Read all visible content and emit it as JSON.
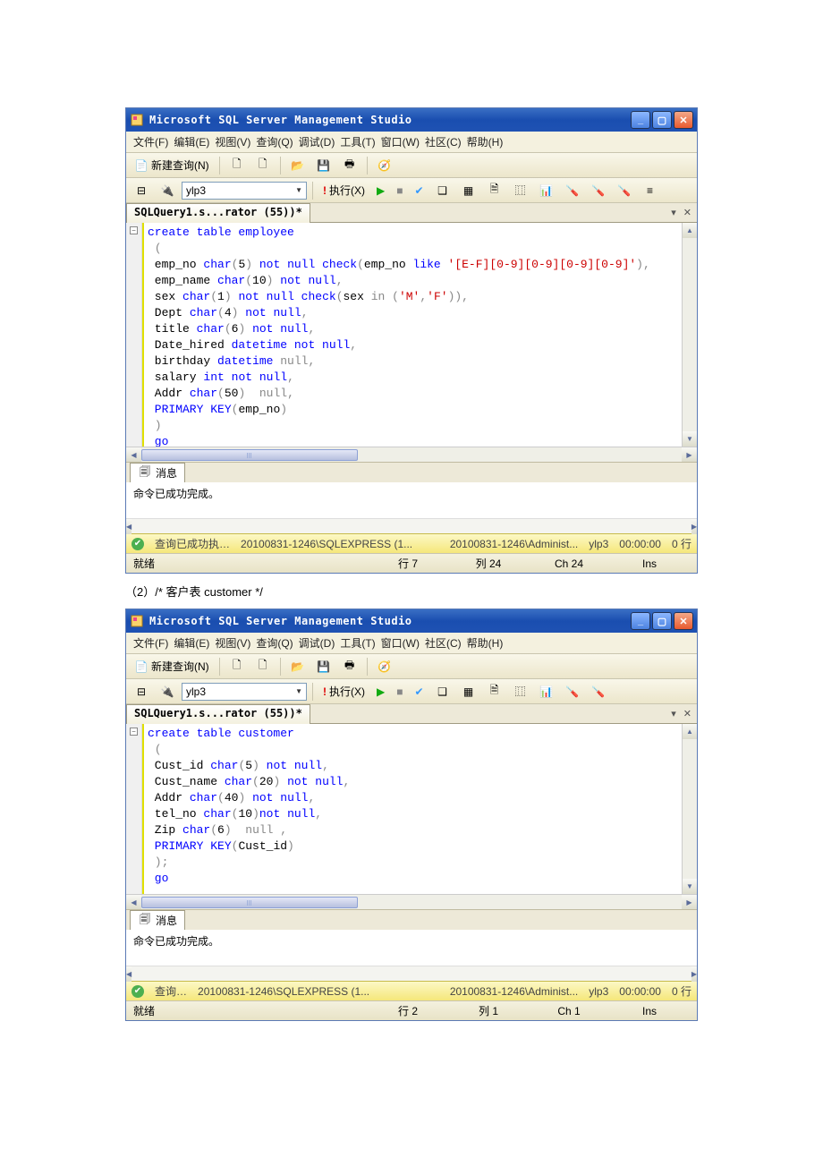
{
  "window1": {
    "title": "Microsoft SQL Server Management Studio",
    "menu": [
      "文件(F)",
      "编辑(E)",
      "视图(V)",
      "查询(Q)",
      "调试(D)",
      "工具(T)",
      "窗口(W)",
      "社区(C)",
      "帮助(H)"
    ],
    "toolbar": {
      "new_query": "新建查询(N)"
    },
    "db": "ylp3",
    "execute": "执行(X)",
    "doc_tab": "SQLQuery1.s...rator (55))*",
    "code_lines": [
      {
        "t": "create table employee",
        "cls": "kw-blue",
        "box": "-"
      },
      {
        "t": " (",
        "cls": "kw-gray"
      },
      {
        "segs": [
          {
            "t": " emp_no ",
            "c": ""
          },
          {
            "t": "char",
            "c": "kw-blue"
          },
          {
            "t": "(",
            "c": "kw-gray"
          },
          {
            "t": "5",
            "c": ""
          },
          {
            "t": ") ",
            "c": "kw-gray"
          },
          {
            "t": "not null check",
            "c": "kw-blue"
          },
          {
            "t": "(",
            "c": "kw-gray"
          },
          {
            "t": "emp_no ",
            "c": ""
          },
          {
            "t": "like ",
            "c": "kw-blue"
          },
          {
            "t": "'[E-F][0-9][0-9][0-9][0-9]'",
            "c": "kw-red"
          },
          {
            "t": "),",
            "c": "kw-gray"
          }
        ]
      },
      {
        "segs": [
          {
            "t": " emp_name ",
            "c": ""
          },
          {
            "t": "char",
            "c": "kw-blue"
          },
          {
            "t": "(",
            "c": "kw-gray"
          },
          {
            "t": "10",
            "c": ""
          },
          {
            "t": ") ",
            "c": "kw-gray"
          },
          {
            "t": "not null",
            "c": "kw-blue"
          },
          {
            "t": ",",
            "c": "kw-gray"
          }
        ]
      },
      {
        "segs": [
          {
            "t": " sex ",
            "c": ""
          },
          {
            "t": "char",
            "c": "kw-blue"
          },
          {
            "t": "(",
            "c": "kw-gray"
          },
          {
            "t": "1",
            "c": ""
          },
          {
            "t": ") ",
            "c": "kw-gray"
          },
          {
            "t": "not null check",
            "c": "kw-blue"
          },
          {
            "t": "(",
            "c": "kw-gray"
          },
          {
            "t": "sex ",
            "c": ""
          },
          {
            "t": "in ",
            "c": "kw-gray"
          },
          {
            "t": "(",
            "c": "kw-gray"
          },
          {
            "t": "'M'",
            "c": "kw-red"
          },
          {
            "t": ",",
            "c": "kw-gray"
          },
          {
            "t": "'F'",
            "c": "kw-red"
          },
          {
            "t": ")),",
            "c": "kw-gray"
          }
        ]
      },
      {
        "segs": [
          {
            "t": " Dept ",
            "c": ""
          },
          {
            "t": "char",
            "c": "kw-blue"
          },
          {
            "t": "(",
            "c": "kw-gray"
          },
          {
            "t": "4",
            "c": ""
          },
          {
            "t": ") ",
            "c": "kw-gray"
          },
          {
            "t": "not null",
            "c": "kw-blue"
          },
          {
            "t": ",",
            "c": "kw-gray"
          }
        ]
      },
      {
        "segs": [
          {
            "t": " title ",
            "c": ""
          },
          {
            "t": "char",
            "c": "kw-blue"
          },
          {
            "t": "(",
            "c": "kw-gray"
          },
          {
            "t": "6",
            "c": ""
          },
          {
            "t": ") ",
            "c": "kw-gray"
          },
          {
            "t": "not null",
            "c": "kw-blue"
          },
          {
            "t": ",",
            "c": "kw-gray"
          }
        ]
      },
      {
        "segs": [
          {
            "t": " Date_hired ",
            "c": ""
          },
          {
            "t": "datetime ",
            "c": "kw-blue"
          },
          {
            "t": "not null",
            "c": "kw-blue"
          },
          {
            "t": ",",
            "c": "kw-gray"
          }
        ]
      },
      {
        "segs": [
          {
            "t": " birthday ",
            "c": ""
          },
          {
            "t": "datetime ",
            "c": "kw-blue"
          },
          {
            "t": "null",
            "c": "kw-gray"
          },
          {
            "t": ",",
            "c": "kw-gray"
          }
        ]
      },
      {
        "segs": [
          {
            "t": " salary ",
            "c": ""
          },
          {
            "t": "int ",
            "c": "kw-blue"
          },
          {
            "t": "not null",
            "c": "kw-blue"
          },
          {
            "t": ",",
            "c": "kw-gray"
          }
        ]
      },
      {
        "segs": [
          {
            "t": " Addr ",
            "c": ""
          },
          {
            "t": "char",
            "c": "kw-blue"
          },
          {
            "t": "(",
            "c": "kw-gray"
          },
          {
            "t": "50",
            "c": ""
          },
          {
            "t": ")  ",
            "c": "kw-gray"
          },
          {
            "t": "null",
            "c": "kw-gray"
          },
          {
            "t": ",",
            "c": "kw-gray"
          }
        ]
      },
      {
        "segs": [
          {
            "t": " PRIMARY KEY",
            "c": "kw-blue"
          },
          {
            "t": "(",
            "c": "kw-gray"
          },
          {
            "t": "emp_no",
            "c": ""
          },
          {
            "t": ")",
            "c": "kw-gray"
          }
        ]
      },
      {
        "t": " )",
        "cls": "kw-gray"
      },
      {
        "t": " go",
        "cls": "kw-blue"
      }
    ],
    "msg_tab": "消息",
    "msg_text": "命令已成功完成。",
    "ok_status": {
      "text": "查询已成功执…",
      "server": "20100831-1246\\SQLEXPRESS (1...",
      "user": "20100831-1246\\Administ...",
      "db": "ylp3",
      "time": "00:00:00",
      "rows": "0 行"
    },
    "statusbar": {
      "ready": "就绪",
      "line": "行 7",
      "col": "列 24",
      "ch": "Ch 24",
      "ins": "Ins"
    }
  },
  "caption": "（2）/* 客户表 customer */",
  "window2": {
    "title": "Microsoft SQL Server Management Studio",
    "menu": [
      "文件(F)",
      "编辑(E)",
      "视图(V)",
      "查询(Q)",
      "调试(D)",
      "工具(T)",
      "窗口(W)",
      "社区(C)",
      "帮助(H)"
    ],
    "toolbar": {
      "new_query": "新建查询(N)"
    },
    "db": "ylp3",
    "execute": "执行(X)",
    "doc_tab": "SQLQuery1.s...rator (55))*",
    "code_lines": [
      {
        "t": "create table customer",
        "cls": "kw-blue",
        "box": "-"
      },
      {
        "t": " (",
        "cls": "kw-gray"
      },
      {
        "segs": [
          {
            "t": " Cust_id ",
            "c": ""
          },
          {
            "t": "char",
            "c": "kw-blue"
          },
          {
            "t": "(",
            "c": "kw-gray"
          },
          {
            "t": "5",
            "c": ""
          },
          {
            "t": ") ",
            "c": "kw-gray"
          },
          {
            "t": "not null",
            "c": "kw-blue"
          },
          {
            "t": ",",
            "c": "kw-gray"
          }
        ]
      },
      {
        "segs": [
          {
            "t": " Cust_name ",
            "c": ""
          },
          {
            "t": "char",
            "c": "kw-blue"
          },
          {
            "t": "(",
            "c": "kw-gray"
          },
          {
            "t": "20",
            "c": ""
          },
          {
            "t": ") ",
            "c": "kw-gray"
          },
          {
            "t": "not null",
            "c": "kw-blue"
          },
          {
            "t": ",",
            "c": "kw-gray"
          }
        ]
      },
      {
        "segs": [
          {
            "t": " Addr ",
            "c": ""
          },
          {
            "t": "char",
            "c": "kw-blue"
          },
          {
            "t": "(",
            "c": "kw-gray"
          },
          {
            "t": "40",
            "c": ""
          },
          {
            "t": ") ",
            "c": "kw-gray"
          },
          {
            "t": "not null",
            "c": "kw-blue"
          },
          {
            "t": ",",
            "c": "kw-gray"
          }
        ]
      },
      {
        "segs": [
          {
            "t": " tel_no ",
            "c": ""
          },
          {
            "t": "char",
            "c": "kw-blue"
          },
          {
            "t": "(",
            "c": "kw-gray"
          },
          {
            "t": "10",
            "c": ""
          },
          {
            "t": ")",
            "c": "kw-gray"
          },
          {
            "t": "not null",
            "c": "kw-blue"
          },
          {
            "t": ",",
            "c": "kw-gray"
          }
        ]
      },
      {
        "segs": [
          {
            "t": " Zip ",
            "c": ""
          },
          {
            "t": "char",
            "c": "kw-blue"
          },
          {
            "t": "(",
            "c": "kw-gray"
          },
          {
            "t": "6",
            "c": ""
          },
          {
            "t": ")  ",
            "c": "kw-gray"
          },
          {
            "t": "null ",
            "c": "kw-gray"
          },
          {
            "t": ",",
            "c": "kw-gray"
          }
        ]
      },
      {
        "segs": [
          {
            "t": " PRIMARY KEY",
            "c": "kw-blue"
          },
          {
            "t": "(",
            "c": "kw-gray"
          },
          {
            "t": "Cust_id",
            "c": ""
          },
          {
            "t": ")",
            "c": "kw-gray"
          }
        ]
      },
      {
        "t": " );",
        "cls": "kw-gray"
      },
      {
        "t": " go",
        "cls": "kw-blue"
      }
    ],
    "msg_tab": "消息",
    "msg_text": "命令已成功完成。",
    "ok_status": {
      "text": "查询…",
      "server": "20100831-1246\\SQLEXPRESS (1...",
      "user": "20100831-1246\\Administ...",
      "db": "ylp3",
      "time": "00:00:00",
      "rows": "0 行"
    },
    "statusbar": {
      "ready": "就绪",
      "line": "行 2",
      "col": "列 1",
      "ch": "Ch 1",
      "ins": "Ins"
    }
  }
}
